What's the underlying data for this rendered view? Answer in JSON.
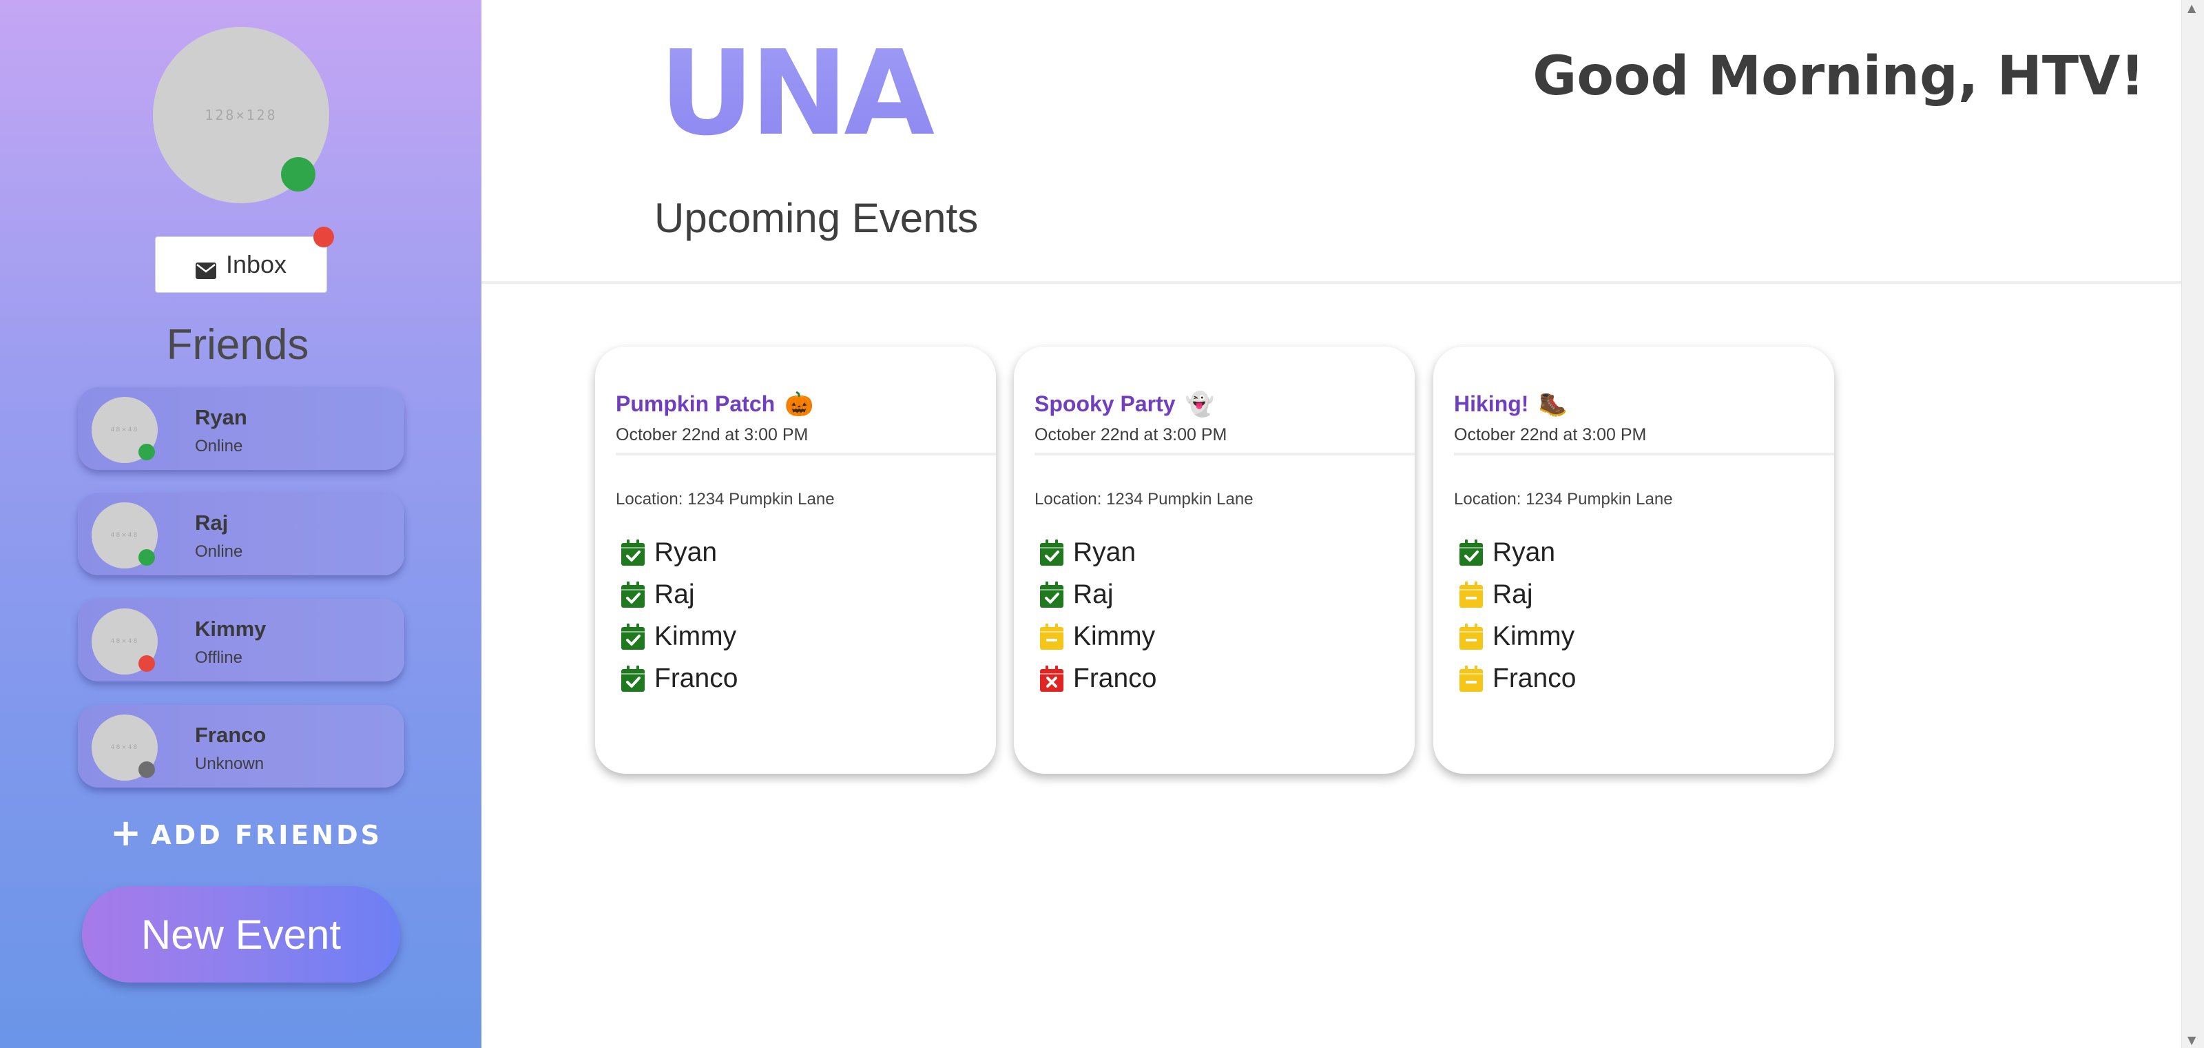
{
  "sidebar": {
    "avatar_placeholder": "128×128",
    "inbox_label": "Inbox",
    "friends_heading": "Friends",
    "friend_avatar_placeholder": "48×48",
    "friends": [
      {
        "name": "Ryan",
        "status": "Online",
        "status_color": "#30a64a"
      },
      {
        "name": "Raj",
        "status": "Online",
        "status_color": "#30a64a"
      },
      {
        "name": "Kimmy",
        "status": "Offline",
        "status_color": "#e8453c"
      },
      {
        "name": "Franco",
        "status": "Unknown",
        "status_color": "#6e6e6e"
      }
    ],
    "add_friends_label": "ADD FRIENDS",
    "new_event_label": "New Event"
  },
  "header": {
    "logo_text": "UNA",
    "greeting": "Good Morning, HTV!",
    "section_title": "Upcoming Events"
  },
  "colors": {
    "accepted": "#1f7a1f",
    "pending": "#f5c518",
    "declined": "#e02424",
    "event_title": "#6f3fbf"
  },
  "events": [
    {
      "title": "Pumpkin Patch",
      "emoji": "🎃",
      "date": "October 22nd at 3:00 PM",
      "location": "Location: 1234 Pumpkin Lane",
      "attendees": [
        {
          "name": "Ryan",
          "rsvp": "accepted"
        },
        {
          "name": "Raj",
          "rsvp": "accepted"
        },
        {
          "name": "Kimmy",
          "rsvp": "accepted"
        },
        {
          "name": "Franco",
          "rsvp": "accepted"
        }
      ]
    },
    {
      "title": "Spooky Party",
      "emoji": "👻",
      "date": "October 22nd at 3:00 PM",
      "location": "Location: 1234 Pumpkin Lane",
      "attendees": [
        {
          "name": "Ryan",
          "rsvp": "accepted"
        },
        {
          "name": "Raj",
          "rsvp": "accepted"
        },
        {
          "name": "Kimmy",
          "rsvp": "pending"
        },
        {
          "name": "Franco",
          "rsvp": "declined"
        }
      ]
    },
    {
      "title": "Hiking!",
      "emoji": "🥾",
      "date": "October 22nd at 3:00 PM",
      "location": "Location: 1234 Pumpkin Lane",
      "attendees": [
        {
          "name": "Ryan",
          "rsvp": "accepted"
        },
        {
          "name": "Raj",
          "rsvp": "pending"
        },
        {
          "name": "Kimmy",
          "rsvp": "pending"
        },
        {
          "name": "Franco",
          "rsvp": "pending"
        }
      ]
    }
  ]
}
